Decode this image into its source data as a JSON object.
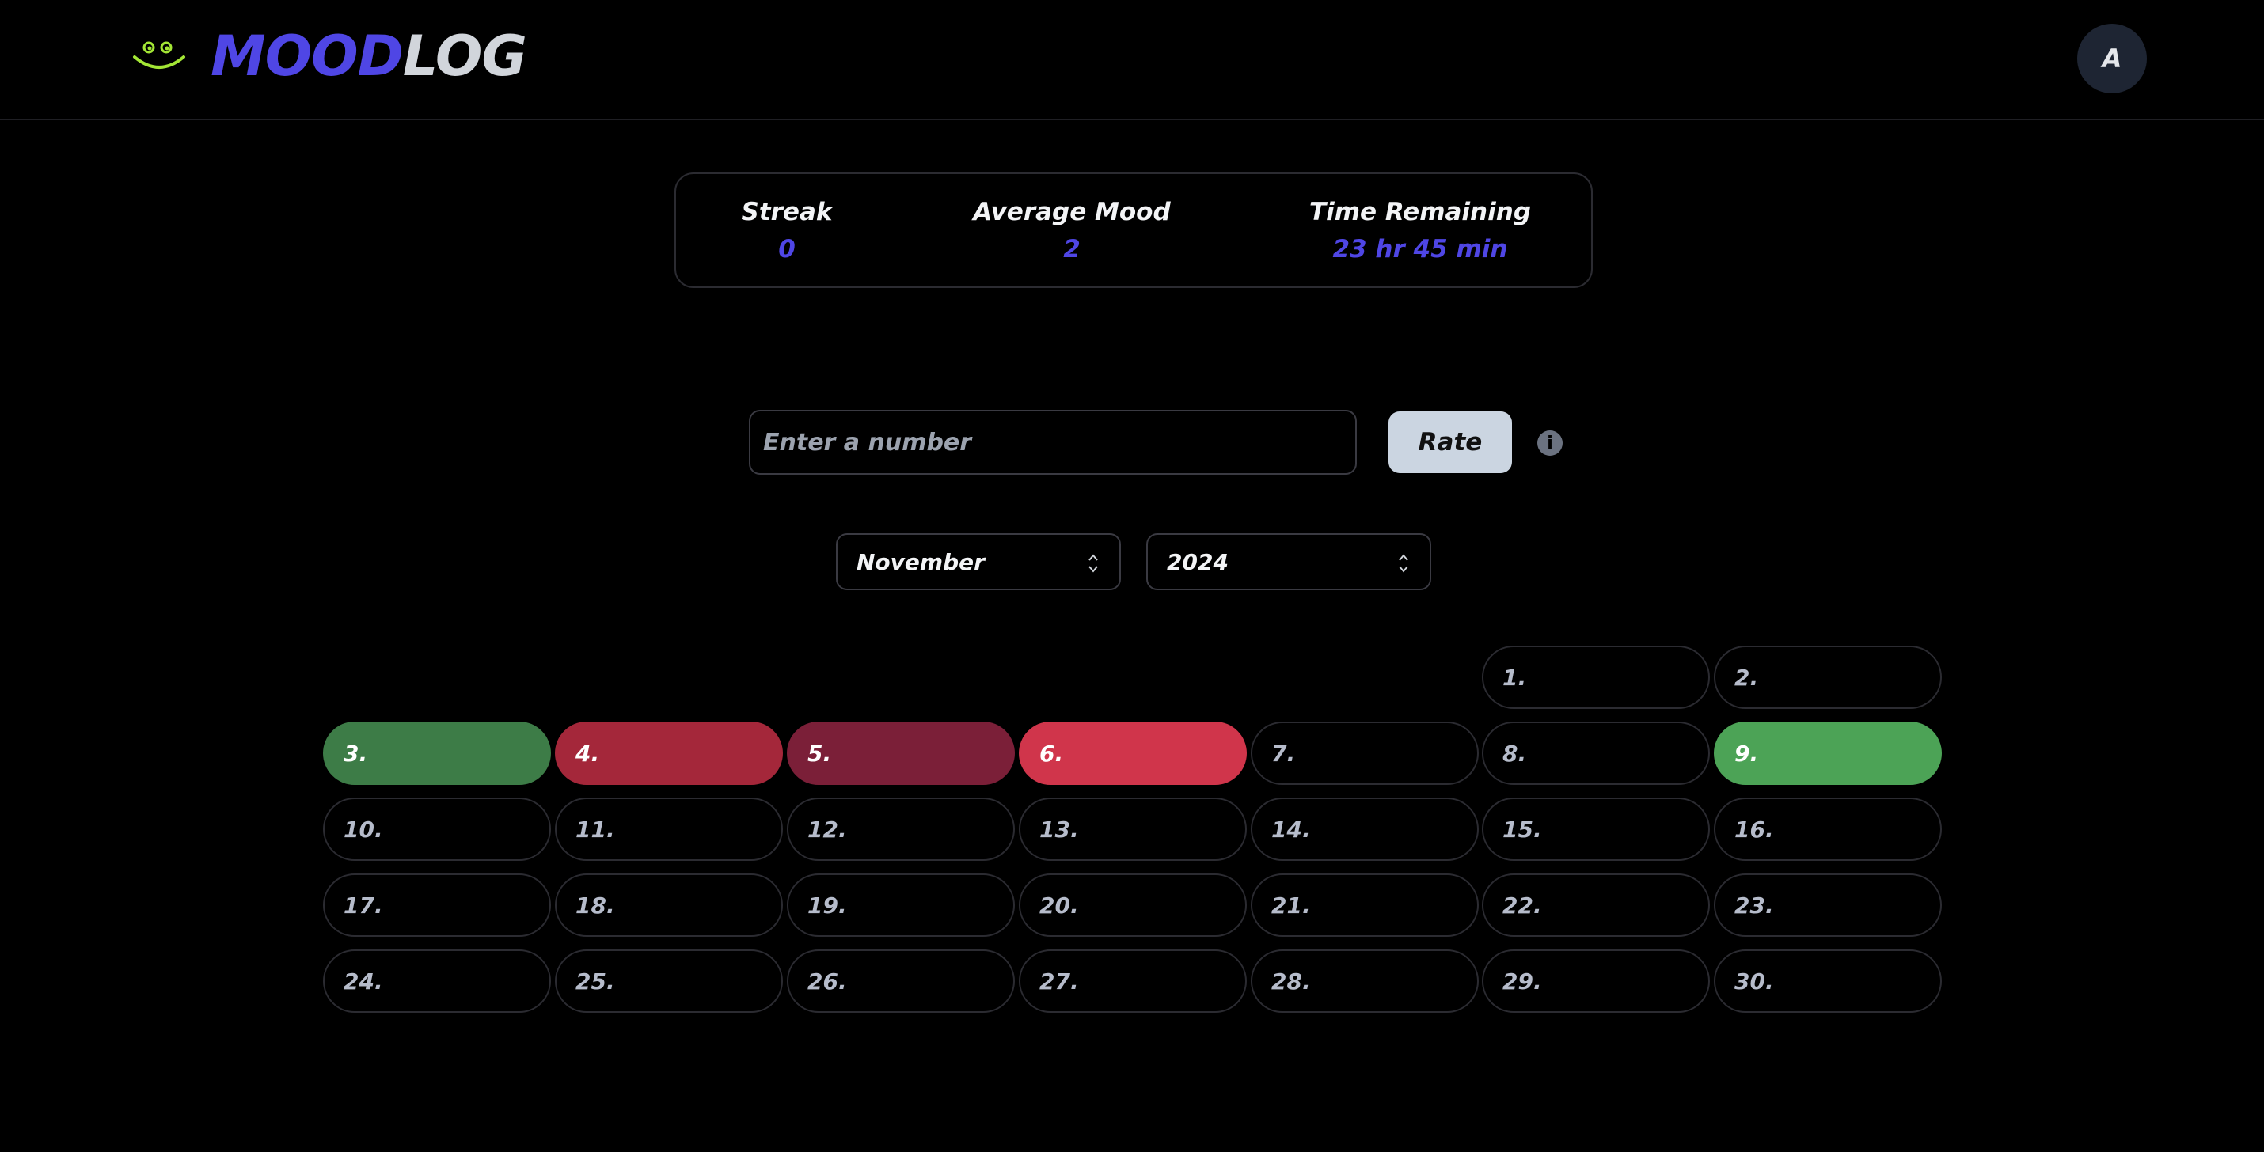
{
  "header": {
    "logo_part1": "MOOD",
    "logo_part2": "LOG",
    "avatar_letter": "A"
  },
  "stats": {
    "streak_label": "Streak",
    "streak_value": "0",
    "avg_label": "Average Mood",
    "avg_value": "2",
    "time_label": "Time Remaining",
    "time_value": "23 hr 45 min"
  },
  "rate": {
    "placeholder": "Enter a number",
    "button_label": "Rate",
    "info_glyph": "i"
  },
  "selects": {
    "month": "November",
    "year": "2024"
  },
  "colors": {
    "accent": "#4f46e5",
    "logo_secondary": "#d1d5db",
    "smiley": "#a3e635"
  },
  "calendar": {
    "first_weekday_index": 5,
    "days": [
      {
        "label": "1.",
        "color": null
      },
      {
        "label": "2.",
        "color": null
      },
      {
        "label": "3.",
        "color": "#3d7c47"
      },
      {
        "label": "4.",
        "color": "#a4273a"
      },
      {
        "label": "5.",
        "color": "#7b1f38"
      },
      {
        "label": "6.",
        "color": "#d0354b"
      },
      {
        "label": "7.",
        "color": null
      },
      {
        "label": "8.",
        "color": null
      },
      {
        "label": "9.",
        "color": "#4ca356"
      },
      {
        "label": "10.",
        "color": null
      },
      {
        "label": "11.",
        "color": null
      },
      {
        "label": "12.",
        "color": null
      },
      {
        "label": "13.",
        "color": null
      },
      {
        "label": "14.",
        "color": null
      },
      {
        "label": "15.",
        "color": null
      },
      {
        "label": "16.",
        "color": null
      },
      {
        "label": "17.",
        "color": null
      },
      {
        "label": "18.",
        "color": null
      },
      {
        "label": "19.",
        "color": null
      },
      {
        "label": "20.",
        "color": null
      },
      {
        "label": "21.",
        "color": null
      },
      {
        "label": "22.",
        "color": null
      },
      {
        "label": "23.",
        "color": null
      },
      {
        "label": "24.",
        "color": null
      },
      {
        "label": "25.",
        "color": null
      },
      {
        "label": "26.",
        "color": null
      },
      {
        "label": "27.",
        "color": null
      },
      {
        "label": "28.",
        "color": null
      },
      {
        "label": "29.",
        "color": null
      },
      {
        "label": "30.",
        "color": null
      }
    ]
  }
}
